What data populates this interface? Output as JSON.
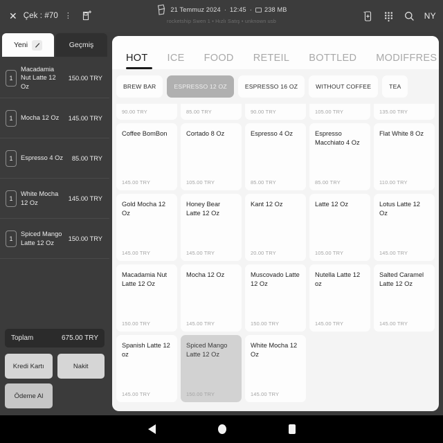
{
  "topbar": {
    "close_label": "✕",
    "check_label": "Çek : #70",
    "overflow_label": "⋮",
    "printer_icon": "printer-add-icon",
    "center": {
      "device_icon": "device-icon",
      "date": "21 Temmuz 2024",
      "sep1": "·",
      "time": "12:45",
      "sep2": "·",
      "memory": "238 MB",
      "subtitle": "rocketship Swen 1 • Hızlı Satış • unknown usb"
    },
    "right": {
      "add_device_icon": "tablet-plus-icon",
      "keypad_icon": "keypad-icon",
      "search_icon": "search-icon",
      "user_initials": "NY"
    }
  },
  "left_panel": {
    "tabs": [
      {
        "label": "Yeni",
        "active": true,
        "icon": "pencil-icon"
      },
      {
        "label": "Geçmiş",
        "active": false
      }
    ],
    "cart_items": [
      {
        "qty": "1",
        "name": "Macadamia Nut Latte 12 Oz",
        "price": "150.00 TRY"
      },
      {
        "qty": "1",
        "name": "Mocha 12 Oz",
        "price": "145.00 TRY"
      },
      {
        "qty": "1",
        "name": "Espresso 4 Oz",
        "price": "85.00 TRY"
      },
      {
        "qty": "1",
        "name": "White Mocha 12 Oz",
        "price": "145.00 TRY"
      },
      {
        "qty": "1",
        "name": "Spiced Mango Latte 12 Oz",
        "price": "150.00 TRY"
      }
    ],
    "total_label": "Toplam",
    "total_value": "675.00 TRY",
    "buttons": {
      "credit_card": "Kredi Kartı",
      "cash": "Nakit",
      "take_payment": "Ödeme Al"
    }
  },
  "main": {
    "tabs": [
      {
        "label": "HOT",
        "active": true
      },
      {
        "label": "ICE",
        "active": false
      },
      {
        "label": "FOOD",
        "active": false
      },
      {
        "label": "RETEIL",
        "active": false
      },
      {
        "label": "BOTTLED",
        "active": false
      },
      {
        "label": "MODIFFRES",
        "active": false
      }
    ],
    "chips": [
      {
        "label": "BREW BAR",
        "active": false
      },
      {
        "label": "ESPRESSO 12 OZ",
        "active": true
      },
      {
        "label": "ESPRESSO 16 OZ",
        "active": false
      },
      {
        "label": "WITHOUT COFFEE",
        "active": false
      },
      {
        "label": "TEA",
        "active": false
      }
    ],
    "products": [
      {
        "name": "",
        "price": "90.00 TRY",
        "selected": false
      },
      {
        "name": "",
        "price": "85.00 TRY",
        "selected": false
      },
      {
        "name": "",
        "price": "90.00 TRY",
        "selected": false
      },
      {
        "name": "",
        "price": "105.00 TRY",
        "selected": false
      },
      {
        "name": "",
        "price": "135.00 TRY",
        "selected": false
      },
      {
        "name": "Coffee BomBon",
        "price": "145.00 TRY",
        "selected": false
      },
      {
        "name": "Cortado 8 Oz",
        "price": "105.00 TRY",
        "selected": false
      },
      {
        "name": "Espresso 4 Oz",
        "price": "85.00 TRY",
        "selected": false
      },
      {
        "name": "Espresso Macchiato 4 Oz",
        "price": "85.00 TRY",
        "selected": false
      },
      {
        "name": "Flat White 8 Oz",
        "price": "110.00 TRY",
        "selected": false
      },
      {
        "name": "Gold Mocha 12 Oz",
        "price": "145.00 TRY",
        "selected": false
      },
      {
        "name": "Honey Bear Latte 12 Oz",
        "price": "145.00 TRY",
        "selected": false
      },
      {
        "name": "Kant 12 Oz",
        "price": "20.00 TRY",
        "selected": false
      },
      {
        "name": "Latte 12 Oz",
        "price": "105.00 TRY",
        "selected": false
      },
      {
        "name": "Lotus Latte 12 Oz",
        "price": "145.00 TRY",
        "selected": false
      },
      {
        "name": "Macadamia Nut Latte 12 Oz",
        "price": "150.00 TRY",
        "selected": false
      },
      {
        "name": "Mocha 12 Oz",
        "price": "145.00 TRY",
        "selected": false
      },
      {
        "name": "Muscovado Latte 12 Oz",
        "price": "150.00 TRY",
        "selected": false
      },
      {
        "name": "Nutella Latte 12 oz",
        "price": "145.00 TRY",
        "selected": false
      },
      {
        "name": "Salted Caramel Latte 12 Oz",
        "price": "145.00 TRY",
        "selected": false
      },
      {
        "name": "Spanish Latte 12 oz",
        "price": "145.00 TRY",
        "selected": false
      },
      {
        "name": "Spiced Mango Latte 12 Oz",
        "price": "150.00 TRY",
        "selected": true
      },
      {
        "name": "White Mocha 12 Oz",
        "price": "145.00 TRY",
        "selected": false
      }
    ]
  },
  "navbar": {
    "back": "back-icon",
    "home": "home-icon",
    "recents": "recents-icon"
  }
}
